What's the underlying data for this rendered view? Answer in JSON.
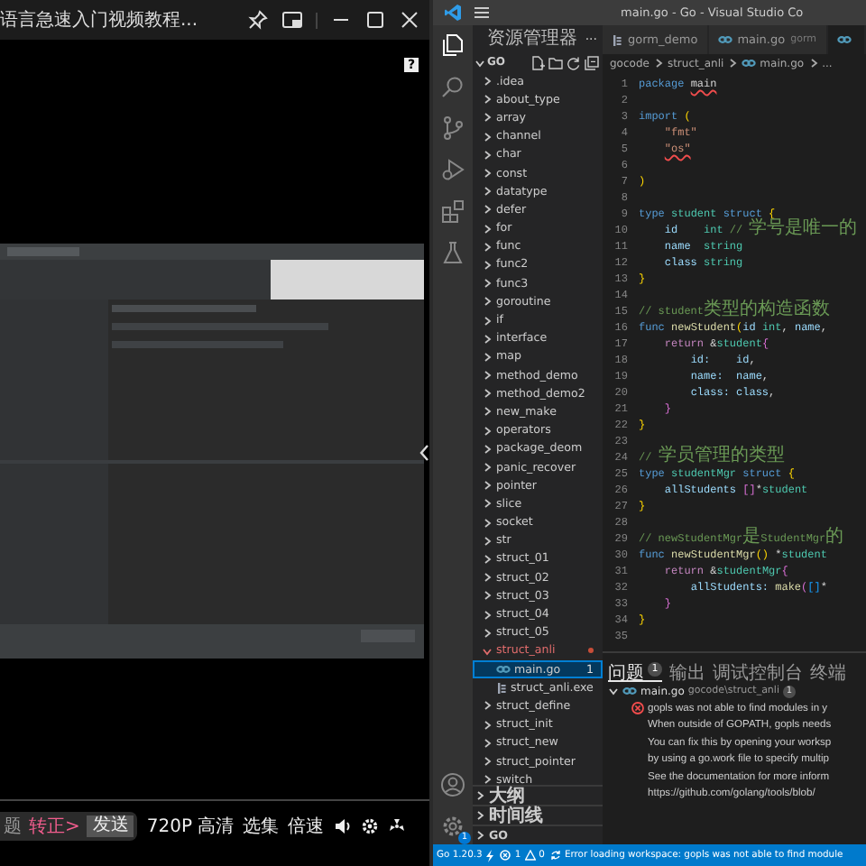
{
  "player": {
    "title": "语言急速入门视频教程...",
    "help": "?",
    "hint": "题",
    "link": "转正>",
    "send": "发送",
    "quality": "720P 高清",
    "episodes": "选集",
    "speed": "倍速"
  },
  "vscode": {
    "window_title": "main.go - Go - Visual Studio Co",
    "settings_badge": "1",
    "explorer": {
      "title": "资源管理器",
      "more": "···",
      "root": "GO",
      "tree": [
        {
          "label": ".idea",
          "kind": "folder",
          "expanded": false
        },
        {
          "label": "about_type",
          "kind": "folder",
          "expanded": false
        },
        {
          "label": "array",
          "kind": "folder",
          "expanded": false
        },
        {
          "label": "channel",
          "kind": "folder",
          "expanded": false
        },
        {
          "label": "char",
          "kind": "folder",
          "expanded": false
        },
        {
          "label": "const",
          "kind": "folder",
          "expanded": false
        },
        {
          "label": "datatype",
          "kind": "folder",
          "expanded": false
        },
        {
          "label": "defer",
          "kind": "folder",
          "expanded": false
        },
        {
          "label": "for",
          "kind": "folder",
          "expanded": false
        },
        {
          "label": "func",
          "kind": "folder",
          "expanded": false
        },
        {
          "label": "func2",
          "kind": "folder",
          "expanded": false
        },
        {
          "label": "func3",
          "kind": "folder",
          "expanded": false
        },
        {
          "label": "goroutine",
          "kind": "folder",
          "expanded": false
        },
        {
          "label": "if",
          "kind": "folder",
          "expanded": false
        },
        {
          "label": "interface",
          "kind": "folder",
          "expanded": false
        },
        {
          "label": "map",
          "kind": "folder",
          "expanded": false
        },
        {
          "label": "method_demo",
          "kind": "folder",
          "expanded": false
        },
        {
          "label": "method_demo2",
          "kind": "folder",
          "expanded": false
        },
        {
          "label": "new_make",
          "kind": "folder",
          "expanded": false
        },
        {
          "label": "operators",
          "kind": "folder",
          "expanded": false
        },
        {
          "label": "package_deom",
          "kind": "folder",
          "expanded": false
        },
        {
          "label": "panic_recover",
          "kind": "folder",
          "expanded": false
        },
        {
          "label": "pointer",
          "kind": "folder",
          "expanded": false
        },
        {
          "label": "slice",
          "kind": "folder",
          "expanded": false
        },
        {
          "label": "socket",
          "kind": "folder",
          "expanded": false
        },
        {
          "label": "str",
          "kind": "folder",
          "expanded": false
        },
        {
          "label": "struct_01",
          "kind": "folder",
          "expanded": false
        },
        {
          "label": "struct_02",
          "kind": "folder",
          "expanded": false
        },
        {
          "label": "struct_03",
          "kind": "folder",
          "expanded": false
        },
        {
          "label": "struct_04",
          "kind": "folder",
          "expanded": false
        },
        {
          "label": "struct_05",
          "kind": "folder",
          "expanded": false
        },
        {
          "label": "struct_anli",
          "kind": "folder",
          "expanded": true,
          "modified": true,
          "children": [
            {
              "label": "main.go",
              "kind": "go",
              "selected": true,
              "badge": "1"
            },
            {
              "label": "struct_anli.exe",
              "kind": "exe",
              "selected": false
            }
          ]
        },
        {
          "label": "struct_define",
          "kind": "folder",
          "expanded": false
        },
        {
          "label": "struct_init",
          "kind": "folder",
          "expanded": false
        },
        {
          "label": "struct_new",
          "kind": "folder",
          "expanded": false
        },
        {
          "label": "struct_pointer",
          "kind": "folder",
          "expanded": false
        },
        {
          "label": "switch",
          "kind": "folder",
          "expanded": false
        }
      ]
    },
    "sections": [
      {
        "label": "大纲",
        "expanded": false
      },
      {
        "label": "时间线",
        "expanded": false
      },
      {
        "label": "GO",
        "expanded": false
      }
    ],
    "tabs": [
      {
        "label": "gorm_demo",
        "kind": "file",
        "selected": false
      },
      {
        "label": "main.go",
        "detail": "gorm",
        "kind": "go",
        "selected": false
      },
      {
        "kind": "go",
        "selected": true
      }
    ],
    "breadcrumb": [
      {
        "label": "gocode",
        "kind": "folder"
      },
      {
        "label": "struct_anli",
        "kind": "folder"
      },
      {
        "label": "main.go",
        "kind": "go"
      },
      {
        "label": "...",
        "kind": "folder"
      }
    ],
    "code": [
      {
        "n": "1",
        "tokens": [
          {
            "kind": "kw",
            "text": "package "
          },
          {
            "kind": "err",
            "text": "main"
          }
        ]
      },
      {
        "n": "2"
      },
      {
        "n": "3",
        "tokens": [
          {
            "kind": "kw",
            "text": "import "
          },
          {
            "kind": "b1",
            "text": "("
          }
        ]
      },
      {
        "n": "4",
        "tokens": [
          {
            "kind": "str",
            "text": "    \"fmt\""
          }
        ]
      },
      {
        "n": "5",
        "tokens": [
          {
            "kind": "strerr",
            "text": "    \"os\""
          }
        ]
      },
      {
        "n": "6"
      },
      {
        "n": "7",
        "tokens": [
          {
            "kind": "b1",
            "text": ")"
          }
        ]
      },
      {
        "n": "8"
      },
      {
        "n": "9",
        "tokens": [
          {
            "kind": "kw",
            "text": "type "
          },
          {
            "kind": "type",
            "text": "student "
          },
          {
            "kind": "kw",
            "text": "struct "
          },
          {
            "kind": "b1",
            "text": "{"
          }
        ]
      },
      {
        "n": "10",
        "tokens": [
          {
            "kind": "var",
            "text": "    id    "
          },
          {
            "kind": "type",
            "text": "int "
          },
          {
            "kind": "com",
            "text": "// 学号是唯一的"
          }
        ]
      },
      {
        "n": "11",
        "tokens": [
          {
            "kind": "var",
            "text": "    name  "
          },
          {
            "kind": "type",
            "text": "string"
          }
        ]
      },
      {
        "n": "12",
        "tokens": [
          {
            "kind": "var",
            "text": "    class "
          },
          {
            "kind": "type",
            "text": "string"
          }
        ]
      },
      {
        "n": "13",
        "tokens": [
          {
            "kind": "b1",
            "text": "}"
          }
        ]
      },
      {
        "n": "14"
      },
      {
        "n": "15",
        "tokens": [
          {
            "kind": "com",
            "text": "// student类型的构造函数"
          }
        ]
      },
      {
        "n": "16",
        "tokens": [
          {
            "kind": "kw",
            "text": "func "
          },
          {
            "kind": "fn",
            "text": "newStudent"
          },
          {
            "kind": "b1",
            "text": "("
          },
          {
            "kind": "var",
            "text": "id "
          },
          {
            "kind": "type",
            "text": "int"
          },
          {
            "kind": "plain",
            "text": ", "
          },
          {
            "kind": "var",
            "text": "name"
          },
          {
            "kind": "plain",
            "text": ","
          }
        ]
      },
      {
        "n": "17",
        "tokens": [
          {
            "kind": "ctl",
            "text": "    return "
          },
          {
            "kind": "plain",
            "text": "&"
          },
          {
            "kind": "type",
            "text": "student"
          },
          {
            "kind": "b2",
            "text": "{"
          }
        ]
      },
      {
        "n": "18",
        "tokens": [
          {
            "kind": "var",
            "text": "        id:    id"
          },
          {
            "kind": "plain",
            "text": ","
          }
        ]
      },
      {
        "n": "19",
        "tokens": [
          {
            "kind": "var",
            "text": "        name:  name"
          },
          {
            "kind": "plain",
            "text": ","
          }
        ]
      },
      {
        "n": "20",
        "tokens": [
          {
            "kind": "var",
            "text": "        class: class"
          },
          {
            "kind": "plain",
            "text": ","
          }
        ]
      },
      {
        "n": "21",
        "tokens": [
          {
            "kind": "b2",
            "text": "    }"
          }
        ]
      },
      {
        "n": "22",
        "tokens": [
          {
            "kind": "b1",
            "text": "}"
          }
        ]
      },
      {
        "n": "23"
      },
      {
        "n": "24",
        "tokens": [
          {
            "kind": "com",
            "text": "// 学员管理的类型"
          }
        ]
      },
      {
        "n": "25",
        "tokens": [
          {
            "kind": "kw",
            "text": "type "
          },
          {
            "kind": "type",
            "text": "studentMgr "
          },
          {
            "kind": "kw",
            "text": "struct "
          },
          {
            "kind": "b1",
            "text": "{"
          }
        ]
      },
      {
        "n": "26",
        "tokens": [
          {
            "kind": "var",
            "text": "    allStudents "
          },
          {
            "kind": "b2",
            "text": "[]"
          },
          {
            "kind": "plain",
            "text": "*"
          },
          {
            "kind": "type",
            "text": "student"
          }
        ]
      },
      {
        "n": "27",
        "tokens": [
          {
            "kind": "b1",
            "text": "}"
          }
        ]
      },
      {
        "n": "28"
      },
      {
        "n": "29",
        "tokens": [
          {
            "kind": "com",
            "text": "// newStudentMgr是StudentMgr的"
          }
        ]
      },
      {
        "n": "30",
        "tokens": [
          {
            "kind": "kw",
            "text": "func "
          },
          {
            "kind": "fn",
            "text": "newStudentMgr"
          },
          {
            "kind": "b1",
            "text": "() "
          },
          {
            "kind": "plain",
            "text": "*"
          },
          {
            "kind": "type",
            "text": "student"
          }
        ]
      },
      {
        "n": "31",
        "tokens": [
          {
            "kind": "ctl",
            "text": "    return "
          },
          {
            "kind": "plain",
            "text": "&"
          },
          {
            "kind": "type",
            "text": "studentMgr"
          },
          {
            "kind": "b2",
            "text": "{"
          }
        ]
      },
      {
        "n": "32",
        "tokens": [
          {
            "kind": "var",
            "text": "        allStudents: "
          },
          {
            "kind": "fn",
            "text": "make"
          },
          {
            "kind": "b2",
            "text": "("
          },
          {
            "kind": "b3",
            "text": "[]"
          },
          {
            "kind": "plain",
            "text": "*"
          }
        ]
      },
      {
        "n": "33",
        "tokens": [
          {
            "kind": "b2",
            "text": "    }"
          }
        ]
      },
      {
        "n": "34",
        "tokens": [
          {
            "kind": "b1",
            "text": "}"
          }
        ]
      },
      {
        "n": "35"
      }
    ],
    "panel": {
      "tabs": [
        {
          "label": "问题",
          "badge": "1",
          "selected": true
        },
        {
          "label": "输出",
          "selected": false
        },
        {
          "label": "调试控制台",
          "selected": false
        },
        {
          "label": "终端",
          "selected": false
        }
      ],
      "file": {
        "name": "main.go",
        "path": "gocode\\struct_anli",
        "count": "1",
        "expanded": true
      },
      "messages": [
        {
          "kind": "error",
          "text": "gopls was not able to find modules in y"
        },
        {
          "kind": "text",
          "text": "When outside of GOPATH, gopls needs"
        },
        {
          "kind": "text",
          "text": "You can fix this by opening your worksp"
        },
        {
          "kind": "text",
          "text": "by using a go.work file to specify multip"
        },
        {
          "kind": "text",
          "text": "See the documentation for more inform"
        },
        {
          "kind": "text",
          "text": "https://github.com/golang/tools/blob/"
        }
      ]
    },
    "status": {
      "go": "Go 1.20.3",
      "errors": "1",
      "warnings": "0",
      "message": "Error loading workspace: gopls was not able to find module"
    }
  }
}
